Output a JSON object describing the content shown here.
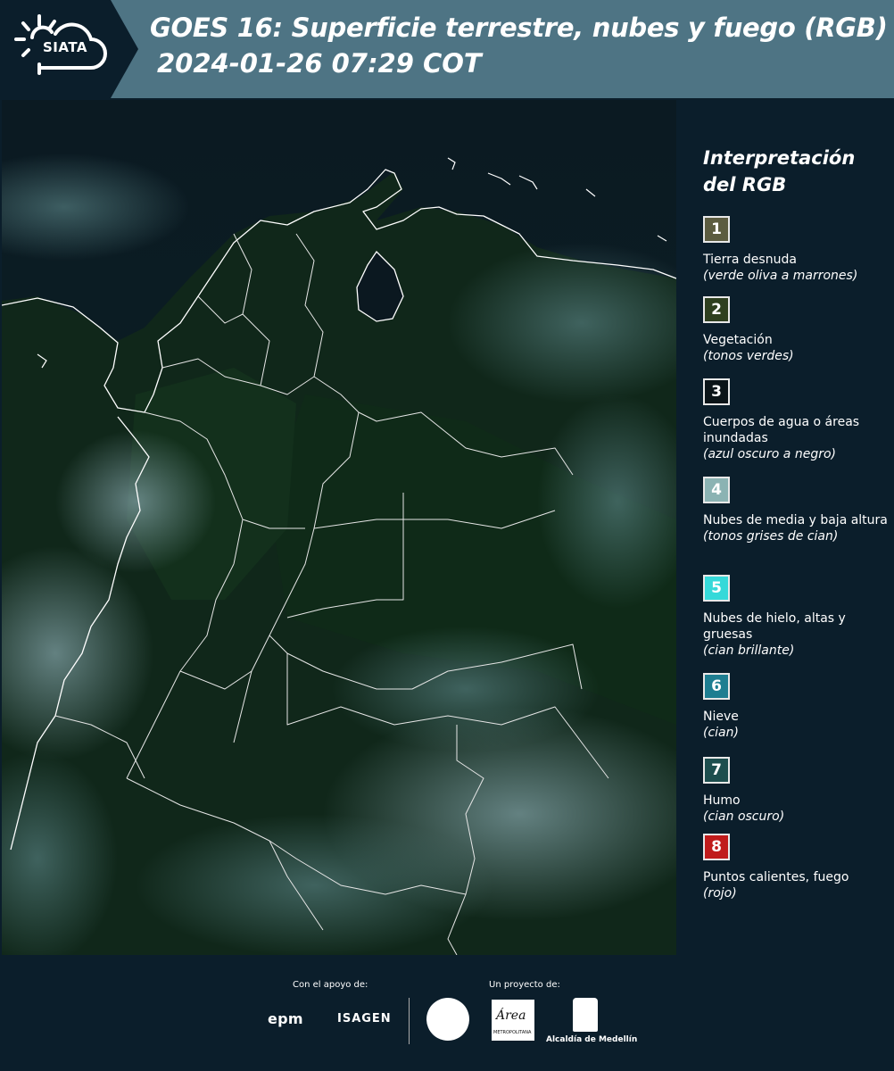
{
  "header": {
    "logo_text": "SIATA",
    "title_line1": "GOES 16: Superficie terrestre, nubes y fuego (RGB)",
    "title_line2": "2024-01-26 07:29 COT"
  },
  "legend": {
    "title_line1": "Interpretación",
    "title_line2": "del RGB",
    "items": [
      {
        "num": "1",
        "color": "#5c5c40",
        "label": "Tierra desnuda",
        "sub": "(verde oliva a marrones)"
      },
      {
        "num": "2",
        "color": "#2e3f1f",
        "label": "Vegetación",
        "sub": "(tonos verdes)"
      },
      {
        "num": "3",
        "color": "#0b1418",
        "label": "Cuerpos de agua o áreas inundadas",
        "sub": "(azul oscuro a negro)"
      },
      {
        "num": "4",
        "color": "#8bb3b3",
        "label": "Nubes de media y baja altura",
        "sub": "(tonos grises de cian)"
      },
      {
        "num": "5",
        "color": "#36d9d9",
        "label": "Nubes de hielo, altas y gruesas",
        "sub": "(cian brillante)"
      },
      {
        "num": "6",
        "color": "#1e7e91",
        "label": "Nieve",
        "sub": "(cian)"
      },
      {
        "num": "7",
        "color": "#1d4e4e",
        "label": "Humo",
        "sub": "(cian oscuro)"
      },
      {
        "num": "8",
        "color": "#c01b1b",
        "label": "Puntos calientes, fuego",
        "sub": "(rojo)"
      }
    ]
  },
  "footer": {
    "support_label": "Con el apoyo de:",
    "project_label": "Un proyecto de:",
    "epm": "epm",
    "isagen": "ISAGEN",
    "area_logo": "Área",
    "area_sub": "METROPOLITANA",
    "alcaldia": "Alcaldía de Medellín"
  }
}
